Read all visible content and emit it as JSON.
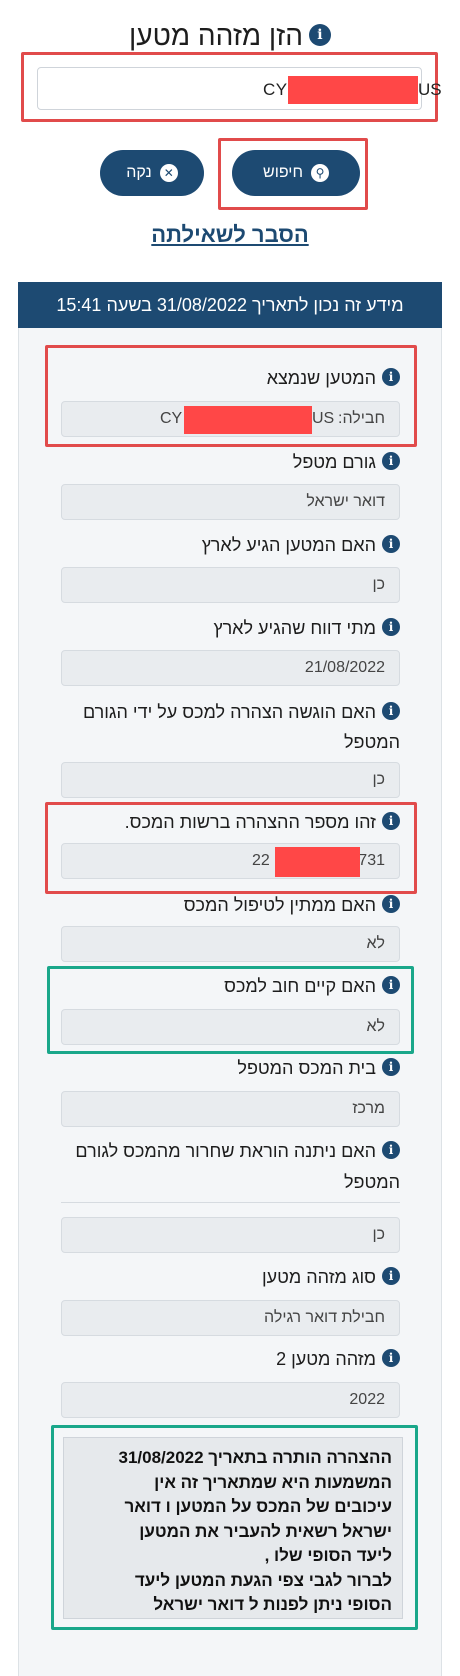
{
  "header": {
    "title": "הזן מזהה מטען",
    "info_glyph": "i"
  },
  "search": {
    "value_prefix": "CY",
    "value_suffix": "US"
  },
  "buttons": {
    "search_label": "חיפוש",
    "clear_label": "נקה"
  },
  "explain_link": "הסבר לשאילתה",
  "results": {
    "header": "מידע זה נכון לתאריך 31/08/2022 בשעה 15:41",
    "fields": [
      {
        "label": "המטען שנמצא",
        "value": "חבילה: CY ... US"
      },
      {
        "label": "גורם מטפל",
        "value": "דואר ישראל"
      },
      {
        "label": "האם המטען הגיע לארץ",
        "value": "כן"
      },
      {
        "label": "מתי דווח שהגיע לארץ",
        "value": "21/08/2022"
      },
      {
        "label": "האם הוגשה הצהרה למכס על ידי הגורם המטפל",
        "value": "כן"
      },
      {
        "label": "זהו מספר ההצהרה ברשות המכס.",
        "value_prefix": "22",
        "value_suffix": "731"
      },
      {
        "label": "האם ממתין לטיפול המכס",
        "value": "לא"
      },
      {
        "label": "האם קיים חוב למכס",
        "value": "לא"
      },
      {
        "label": "בית המכס המטפל",
        "value": "מרכז"
      },
      {
        "label": "האם ניתנה הוראת שחרור מהמכס לגורם המטפל",
        "value": "כן"
      },
      {
        "label": "סוג מזהה מטען",
        "value": "חבילת דואר רגילה"
      },
      {
        "label": "מזהה מטען 2",
        "value": "2022"
      }
    ],
    "found_prefix": "חבילה: ",
    "found_cy": "CY",
    "found_us": "US",
    "note_lines": [
      "ההצהרה הותרה בתאריך 31/08/2022",
      "המשמעות היא שמתאריך זה אין",
      "עיכובים של המכס על המטען ו דואר",
      "ישראל רשאית להעביר את המטען",
      "ליעד הסופי שלו ,",
      "לברור לגבי צפי הגעת המטען ליעד",
      "הסופי ניתן לפנות ל דואר ישראל"
    ]
  },
  "colors": {
    "primary": "#1d4a72",
    "highlight_red": "#e14b4b",
    "highlight_green": "#19a78a",
    "redaction": "#ff4747"
  }
}
